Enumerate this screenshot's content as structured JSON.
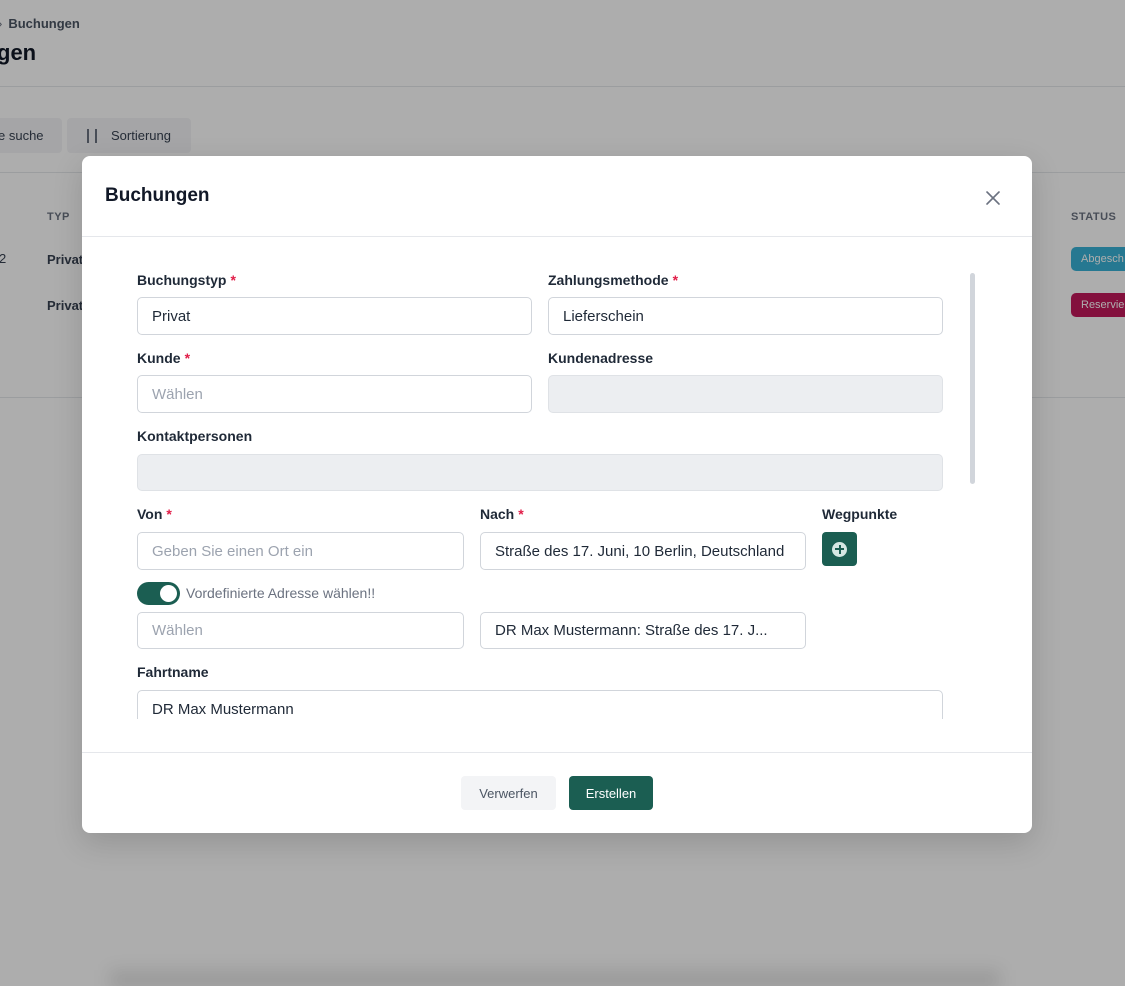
{
  "background": {
    "breadcrumb": {
      "current": "Buchungen"
    },
    "page_title": "gen",
    "search_button_label": "e suche",
    "sort_button_label": "Sortierung",
    "table": {
      "columns": {
        "typ": "TYP",
        "status": "STATUS"
      },
      "rows": [
        {
          "id_fragment": "2",
          "typ": "Privat",
          "status": "Abgesch"
        },
        {
          "id_fragment": "",
          "typ": "Privat",
          "status": "Reservie"
        }
      ]
    }
  },
  "modal": {
    "title": "Buchungen",
    "fields": {
      "buchungstyp": {
        "label": "Buchungstyp",
        "required_mark": "*",
        "value": "Privat"
      },
      "zahlungsmethode": {
        "label": "Zahlungsmethode",
        "required_mark": "*",
        "value": "Lieferschein"
      },
      "kunde": {
        "label": "Kunde",
        "required_mark": "*",
        "placeholder": "Wählen"
      },
      "kundenadresse": {
        "label": "Kundenadresse",
        "value": ""
      },
      "kontaktpersonen": {
        "label": "Kontaktpersonen",
        "value": ""
      },
      "von": {
        "label": "Von",
        "required_mark": "*",
        "placeholder": "Geben Sie einen Ort ein"
      },
      "nach": {
        "label": "Nach",
        "required_mark": "*",
        "value": "Straße des 17. Juni, 10 Berlin, Deutschland"
      },
      "wegpunkte": {
        "label": "Wegpunkte"
      },
      "predefined_toggle": {
        "label": "Vordefinierte Adresse wählen!!",
        "checked": true
      },
      "von_select": {
        "placeholder": "Wählen"
      },
      "nach_select": {
        "value": "DR Max Mustermann: Straße des 17. J..."
      },
      "fahrtname": {
        "label": "Fahrtname",
        "value": "DR Max Mustermann"
      }
    },
    "footer": {
      "discard_label": "Verwerfen",
      "create_label": "Erstellen"
    }
  },
  "colors": {
    "primary": "#1b5e52",
    "required": "#e11d48",
    "badge_done": "#38b2d6",
    "badge_reserved": "#c2185b"
  }
}
